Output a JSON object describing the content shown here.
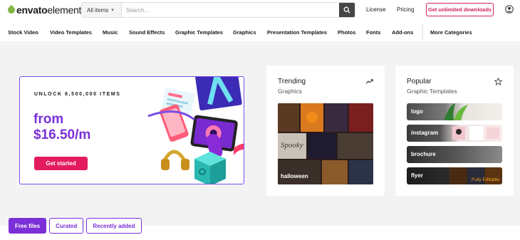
{
  "header": {
    "logo_part1": "envato",
    "logo_part2": "elements",
    "search_category": "All items",
    "search_placeholder": "Search...",
    "link_license": "License",
    "link_pricing": "Pricing",
    "cta_unlimited": "Get unlimited downloads"
  },
  "nav": {
    "items": [
      "Stock Video",
      "Video Templates",
      "Music",
      "Sound Effects",
      "Graphic Templates",
      "Graphics",
      "Presentation Templates",
      "Photos",
      "Fonts",
      "Add-ons",
      "More Categories"
    ]
  },
  "hero": {
    "eyebrow": "UNLOCK 6,500,000 ITEMS",
    "price_line1": "from",
    "price_line2": "$16.50/m",
    "button": "Get started"
  },
  "trending": {
    "title": "Trending",
    "subtitle": "Graphics",
    "image_label": "halloween",
    "icon": "trending-up-icon"
  },
  "popular": {
    "title": "Popular",
    "subtitle": "Graphic Templates",
    "icon": "star-outline-icon",
    "rows": [
      {
        "label": "logo"
      },
      {
        "label": "instagram"
      },
      {
        "label": "brochure"
      },
      {
        "label": "flyer",
        "tag": "Fully Editable"
      }
    ]
  },
  "tabs": {
    "items": [
      "Free files",
      "Curated",
      "Recently added"
    ],
    "active": "Free files"
  },
  "colors": {
    "accent_purple": "#7b2fd8",
    "cta_pink": "#e31c5f",
    "logo_green": "#82b541"
  }
}
